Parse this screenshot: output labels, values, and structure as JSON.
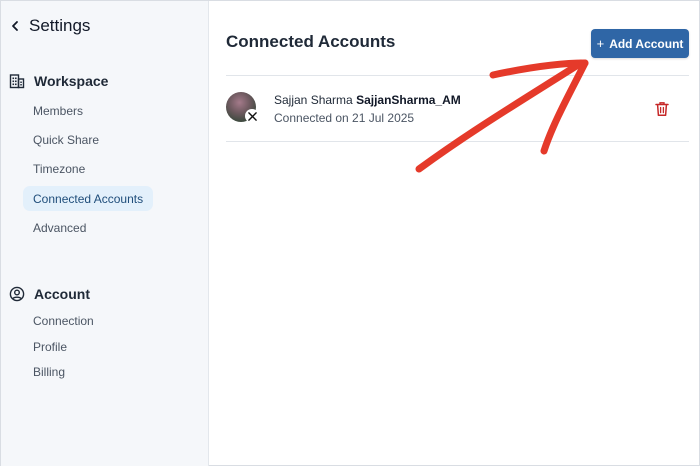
{
  "sidebar": {
    "title": "Settings",
    "back_icon": "chevron-left-icon",
    "sections": [
      {
        "label": "Workspace",
        "icon": "building-icon",
        "items": [
          {
            "label": "Members"
          },
          {
            "label": "Quick Share"
          },
          {
            "label": "Timezone"
          },
          {
            "label": "Connected Accounts",
            "active": true
          },
          {
            "label": "Advanced"
          }
        ]
      },
      {
        "label": "Account",
        "icon": "user-circle-icon",
        "items": [
          {
            "label": "Connection"
          },
          {
            "label": "Profile"
          },
          {
            "label": "Billing"
          }
        ]
      }
    ]
  },
  "main": {
    "title": "Connected Accounts",
    "add_button": {
      "plus": "+",
      "label": "Add Account"
    },
    "accounts": [
      {
        "name": "Sajjan Sharma",
        "handle": "SajjanSharma_AM",
        "connected": "Connected on 21 Jul 2025",
        "platform_icon": "x-logo-icon",
        "delete_icon": "trash-icon"
      }
    ]
  },
  "colors": {
    "accent": "#2f66a6",
    "active_bg": "#e3f0fb",
    "danger": "#c62828",
    "annotation": "#e53a2a"
  }
}
